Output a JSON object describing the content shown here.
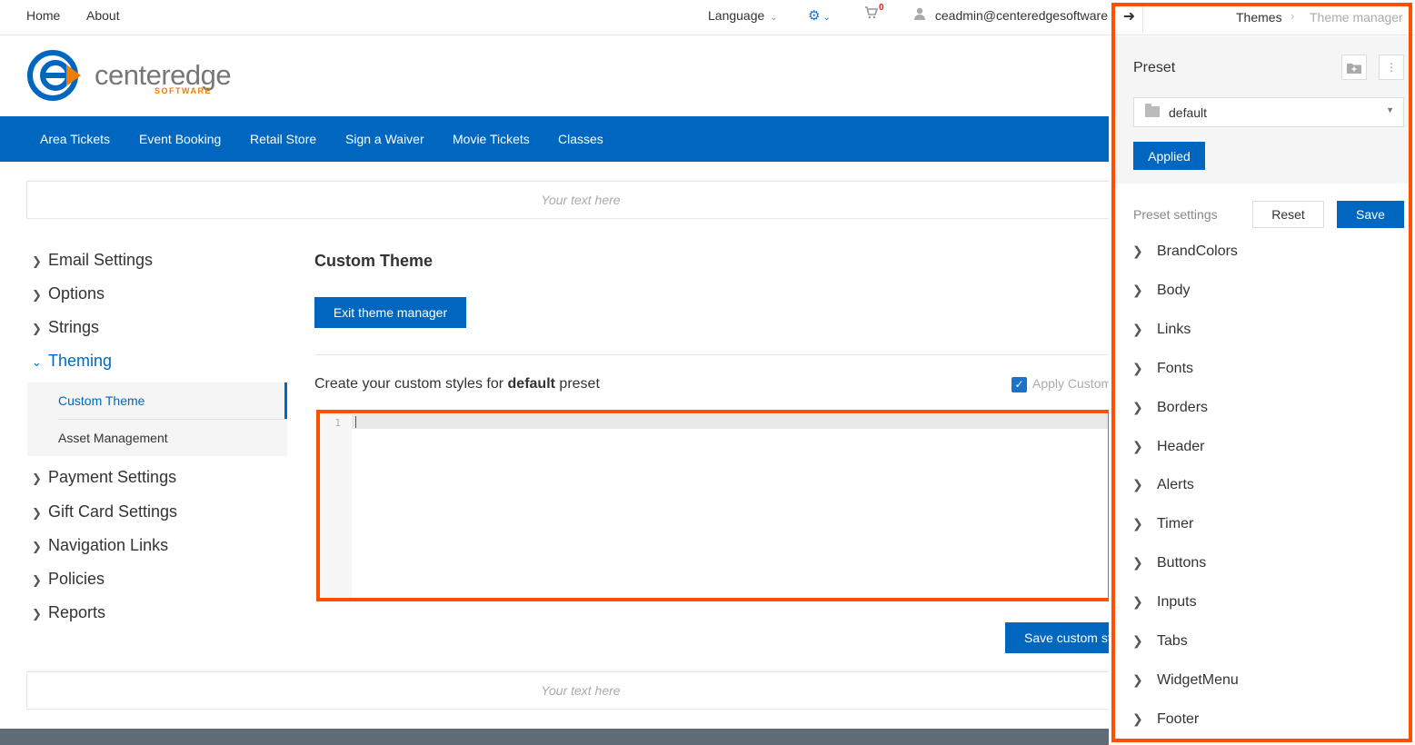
{
  "topbar": {
    "home": "Home",
    "about": "About",
    "language": "Language",
    "cart_count": "0",
    "user_email": "ceadmin@centeredgesoftware"
  },
  "logo": {
    "word": "centeredge",
    "sub": "SOFTWARE"
  },
  "nav": [
    "Area Tickets",
    "Event Booking",
    "Retail Store",
    "Sign a Waiver",
    "Movie Tickets",
    "Classes"
  ],
  "banner": {
    "top_text": "Your text here",
    "bottom_text": "Your text here"
  },
  "sidebar": {
    "items": [
      "Email Settings",
      "Options",
      "Strings",
      "Theming",
      "Payment Settings",
      "Gift Card Settings",
      "Navigation Links",
      "Policies",
      "Reports"
    ],
    "sub_items": [
      "Custom Theme",
      "Asset Management"
    ]
  },
  "main": {
    "title": "Custom Theme",
    "exit_button": "Exit theme manager",
    "create_prefix": "Create your custom styles for ",
    "create_bold": "default",
    "create_suffix": " preset",
    "apply_label": "Apply Custom",
    "line_number": "1",
    "save_button": "Save custom styles"
  },
  "panel": {
    "crumb_themes": "Themes",
    "crumb_current": "Theme manager",
    "preset_label": "Preset",
    "preset_value": "default",
    "applied_button": "Applied",
    "preset_settings_label": "Preset settings",
    "reset_button": "Reset",
    "save_button": "Save",
    "categories": [
      "BrandColors",
      "Body",
      "Links",
      "Fonts",
      "Borders",
      "Header",
      "Alerts",
      "Timer",
      "Buttons",
      "Inputs",
      "Tabs",
      "WidgetMenu",
      "Footer"
    ]
  },
  "colors": {
    "brand_blue": "#0067c0",
    "highlight": "#ff4f00",
    "logo_orange": "#f07c00"
  }
}
